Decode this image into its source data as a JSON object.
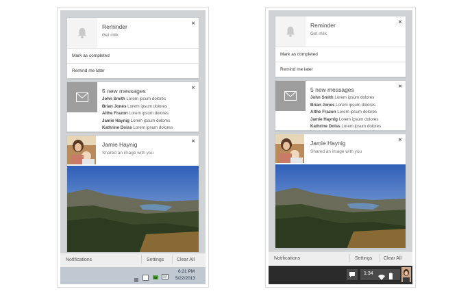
{
  "panels": [
    {
      "id": "left",
      "reminder": {
        "title": "Reminder",
        "subtitle": "Get milk",
        "actions": [
          "Mark as completed",
          "Remind me later"
        ]
      },
      "messages": {
        "title": "5 new messages",
        "items": [
          {
            "name": "John Smith",
            "text": "Lorem ipsum dolores"
          },
          {
            "name": "Brian Jones",
            "text": "Lorem ipsum dolores"
          },
          {
            "name": "Althe Frazon",
            "text": "Lorem ipsum dolores"
          },
          {
            "name": "Jamie Haynig",
            "text": "Lorem ipsum dolores"
          },
          {
            "name": "Kathrine Doiss",
            "text": "Lorem ipsum dolores"
          }
        ]
      },
      "image_notification": {
        "title": "Jamie Haynig",
        "subtitle": "Shared an image with you"
      },
      "footer": {
        "notifications": "Notifications",
        "settings": "Settings",
        "clear_all": "Clear All"
      },
      "taskbar": {
        "time": "6:21 PM",
        "date": "5/22/2013"
      }
    },
    {
      "id": "right",
      "reminder": {
        "title": "Reminder",
        "subtitle": "Get milk",
        "actions": [
          "Mark as completed",
          "Remind me later"
        ]
      },
      "messages": {
        "title": "5 new messages",
        "items": [
          {
            "name": "John Smith",
            "text": "Lorem ipsum dolores"
          },
          {
            "name": "Brian Jones",
            "text": "Lorem ipsum dolores"
          },
          {
            "name": "Althe Frazon",
            "text": "Lorem ipsum dolores"
          },
          {
            "name": "Jamie Haynig",
            "text": "Lorem ipsum dolores"
          },
          {
            "name": "Kathrine Doiss",
            "text": "Lorem ipsum dolores"
          }
        ]
      },
      "image_notification": {
        "title": "Jamie Haynig",
        "subtitle": "Shared an image with you"
      },
      "footer": {
        "notifications": "Notifications",
        "settings": "Settings",
        "clear_all": "Clear All"
      },
      "taskbar": {
        "time": "1:34"
      }
    }
  ],
  "close_glyph": "×",
  "icons": [
    "bell-icon",
    "envelope-icon",
    "close-icon",
    "flag-icon",
    "speaker-icon",
    "network-icon",
    "chat-icon",
    "wifi-icon",
    "battery-icon"
  ]
}
